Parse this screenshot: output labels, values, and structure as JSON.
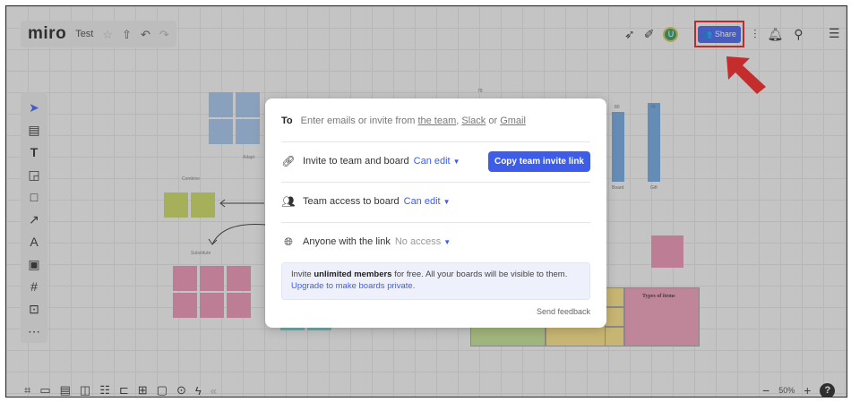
{
  "app": {
    "logo": "miro",
    "board_name": "Test",
    "icons": {
      "star": "star-icon",
      "upload": "upload-icon",
      "undo": "undo-icon",
      "redo": "redo-icon"
    }
  },
  "header_right": {
    "avatar_initial": "U",
    "share_label": "Share",
    "highlight_color": "#e21b1b",
    "accent_color": "#3d5de8"
  },
  "canvas": {
    "labels": {
      "adapt": "Adapt",
      "combine": "Combine",
      "substitute": "Substitute"
    },
    "chart": {
      "bar_values": [
        "80",
        "79"
      ],
      "bar_categories": [
        "Board",
        "Gift"
      ],
      "top_label": "79"
    },
    "table_header": "Types of items"
  },
  "modal": {
    "to_label": "To",
    "to_placeholder_pre": "Enter emails or invite from ",
    "to_placeholder_link1": "the team",
    "to_placeholder_mid1": ", ",
    "to_placeholder_link2": "Slack",
    "to_placeholder_mid2": " or ",
    "to_placeholder_link3": "Gmail",
    "invite_label": "Invite to team and board",
    "invite_perm": "Can edit",
    "copy_button": "Copy team invite link",
    "team_access_label": "Team access to board",
    "team_access_perm": "Can edit",
    "link_label": "Anyone with the link",
    "link_perm": "No access",
    "info_pre": "Invite ",
    "info_bold": "unlimited members",
    "info_post": " for free. All your boards will be visible to them.",
    "info_link": "Upgrade to make boards private.",
    "feedback": "Send feedback"
  },
  "zoom": {
    "value": "50%",
    "minus": "−",
    "plus": "+",
    "help": "?"
  }
}
